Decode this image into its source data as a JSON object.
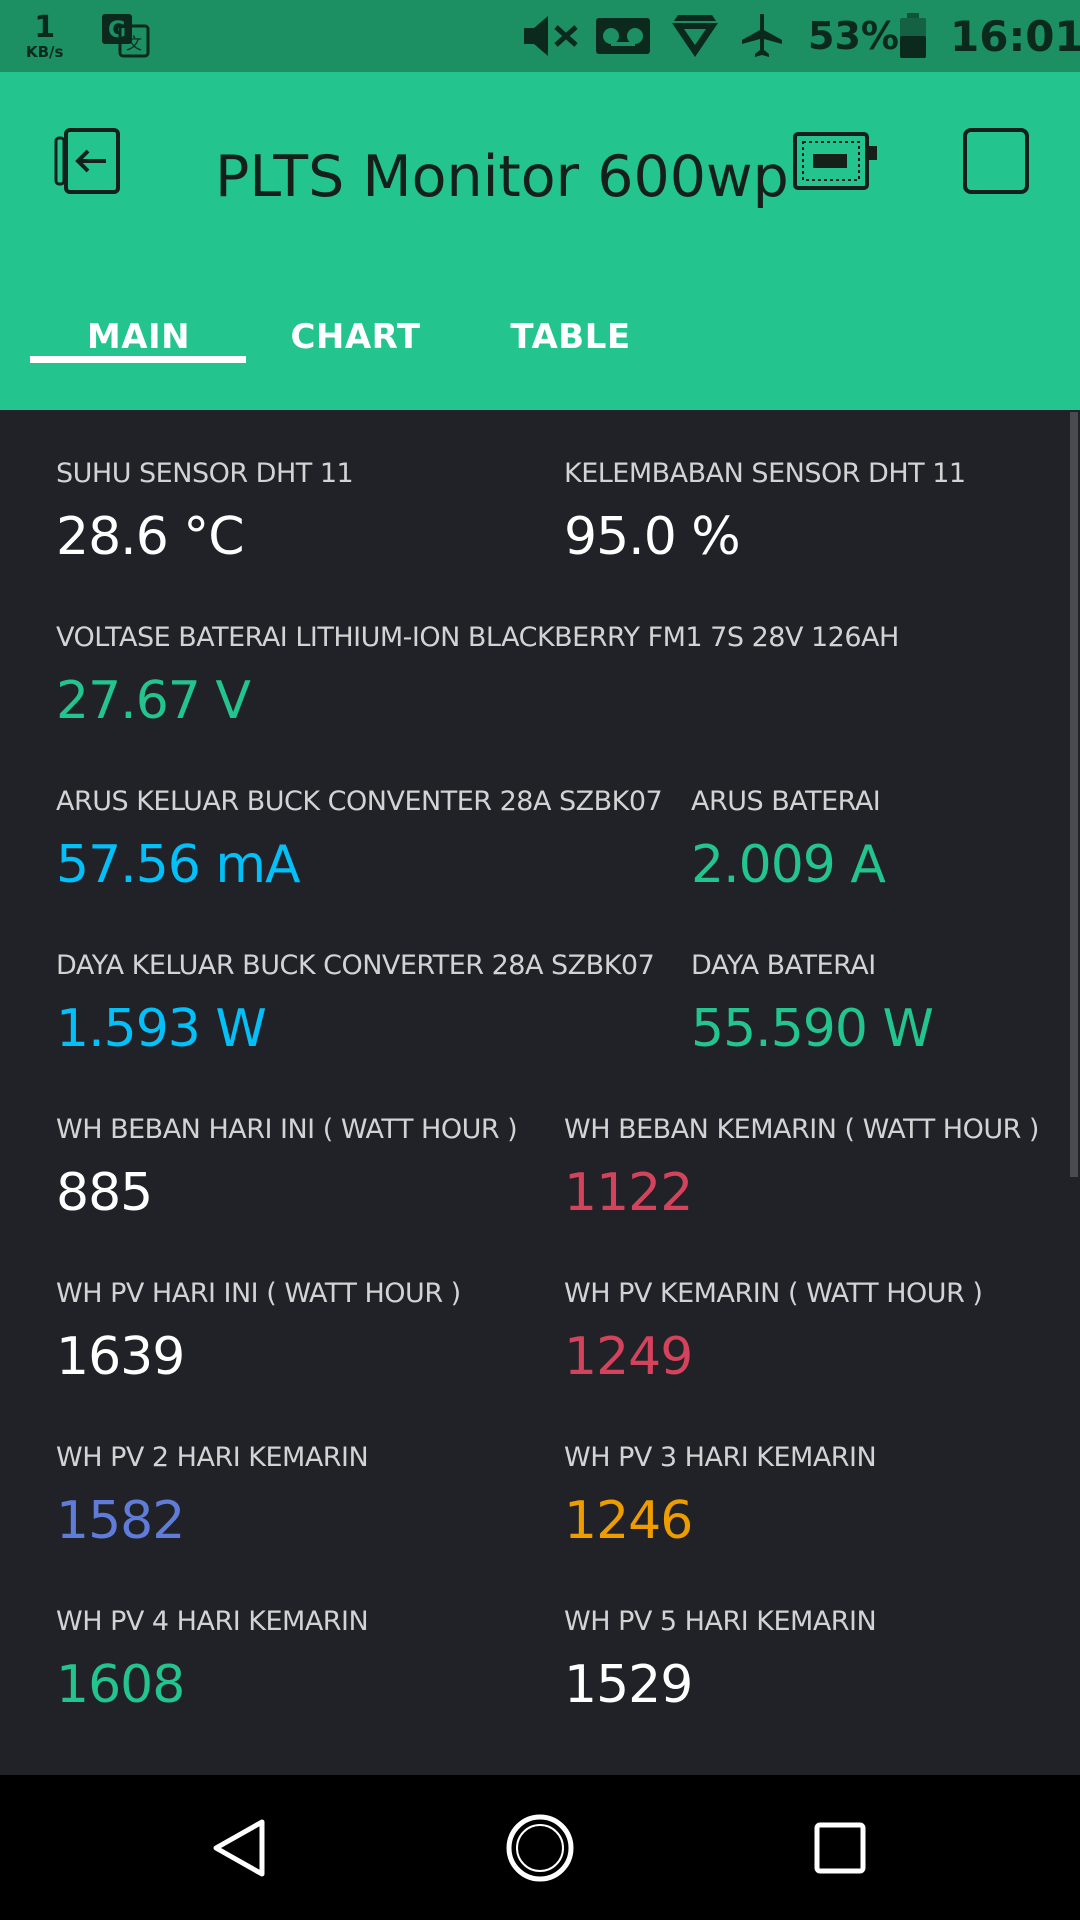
{
  "status_bar": {
    "net_speed_value": "1",
    "net_speed_unit": "KB/s",
    "battery_percent": "53%",
    "time": "16:01",
    "icons": [
      "translate-icon",
      "mute-icon",
      "voicemail-icon",
      "signal-icon",
      "airplane-icon",
      "battery-icon"
    ]
  },
  "app_bar": {
    "title": "PLTS Monitor 600wp",
    "left_icon": "exit-icon",
    "right_icons": [
      "device-icon",
      "square-icon"
    ],
    "accent": "#23c48e"
  },
  "tabs": [
    {
      "label": "MAIN",
      "active": true
    },
    {
      "label": "CHART",
      "active": false
    },
    {
      "label": "TABLE",
      "active": false
    }
  ],
  "widgets": [
    {
      "label": "SUHU SENSOR DHT 11",
      "value": "28.6 °C",
      "color": "#ffffff"
    },
    {
      "label": "KELEMBABAN SENSOR DHT 11",
      "value": "95.0 %",
      "color": "#ffffff"
    },
    {
      "label": "VOLTASE BATERAI LITHIUM-ION BLACKBERRY FM1 7S 28V 126AH",
      "value": "27.67 V",
      "color": "#23c48e"
    },
    {
      "label": "ARUS KELUAR BUCK CONVENTER 28A SZBK07",
      "value": "57.56 mA",
      "color": "#04c0f8"
    },
    {
      "label": "ARUS BATERAI",
      "value": "2.009 A",
      "color": "#23c48e"
    },
    {
      "label": "DAYA KELUAR BUCK CONVERTER 28A SZBK07",
      "value": "1.593 W",
      "color": "#04c0f8"
    },
    {
      "label": "DAYA BATERAI",
      "value": "55.590 W",
      "color": "#23c48e"
    },
    {
      "label": "WH BEBAN HARI INI ( WATT HOUR )",
      "value": "885",
      "color": "#ffffff"
    },
    {
      "label": "WH BEBAN KEMARIN ( WATT HOUR )",
      "value": "1122",
      "color": "#d3435c"
    },
    {
      "label": "WH PV HARI INI ( WATT HOUR )",
      "value": "1639",
      "color": "#ffffff"
    },
    {
      "label": "WH PV KEMARIN ( WATT HOUR )",
      "value": "1249",
      "color": "#d3435c"
    },
    {
      "label": "WH PV 2 HARI KEMARIN",
      "value": "1582",
      "color": "#5f7cd8"
    },
    {
      "label": "WH PV 3 HARI KEMARIN",
      "value": "1246",
      "color": "#ed9d00"
    },
    {
      "label": "WH PV 4 HARI KEMARIN",
      "value": "1608",
      "color": "#23c48e"
    },
    {
      "label": "WH PV 5 HARI KEMARIN",
      "value": "1529",
      "color": "#ffffff"
    }
  ],
  "nav_bar": {
    "icons": [
      "back-icon",
      "home-icon",
      "recents-icon"
    ]
  }
}
